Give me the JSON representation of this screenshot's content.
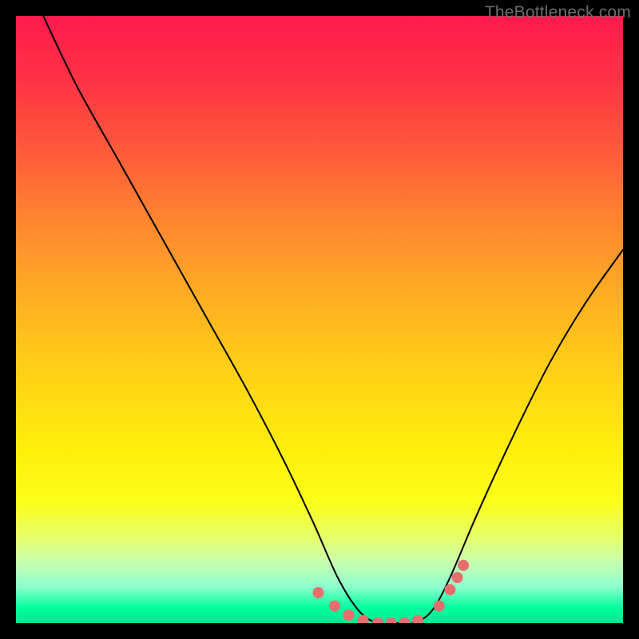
{
  "watermark": "TheBottleneck.com",
  "chart_data": {
    "type": "line",
    "title": "",
    "xlabel": "",
    "ylabel": "",
    "xlim": [
      0,
      1
    ],
    "ylim": [
      0,
      1
    ],
    "series": [
      {
        "name": "bottleneck-curve",
        "x": [
          0.045,
          0.1,
          0.17,
          0.24,
          0.31,
          0.38,
          0.44,
          0.49,
          0.53,
          0.565,
          0.595,
          0.625,
          0.655,
          0.685,
          0.715,
          0.76,
          0.82,
          0.88,
          0.94,
          1.0
        ],
        "y": [
          1.0,
          0.885,
          0.76,
          0.635,
          0.51,
          0.385,
          0.27,
          0.165,
          0.075,
          0.02,
          0.0,
          0.0,
          0.0,
          0.02,
          0.075,
          0.18,
          0.31,
          0.43,
          0.53,
          0.615
        ]
      }
    ],
    "markers": {
      "name": "highlight-dots",
      "color": "#e86e6e",
      "points": [
        {
          "x": 0.498,
          "y": 0.05
        },
        {
          "x": 0.525,
          "y": 0.028
        },
        {
          "x": 0.548,
          "y": 0.013
        },
        {
          "x": 0.572,
          "y": 0.004
        },
        {
          "x": 0.596,
          "y": 0.0
        },
        {
          "x": 0.618,
          "y": 0.0
        },
        {
          "x": 0.64,
          "y": 0.0
        },
        {
          "x": 0.662,
          "y": 0.004
        },
        {
          "x": 0.697,
          "y": 0.028
        },
        {
          "x": 0.715,
          "y": 0.055
        },
        {
          "x": 0.727,
          "y": 0.075
        },
        {
          "x": 0.737,
          "y": 0.095
        }
      ]
    },
    "background": "vertical-gradient red→yellow→green (bottleneck heatmap)"
  }
}
